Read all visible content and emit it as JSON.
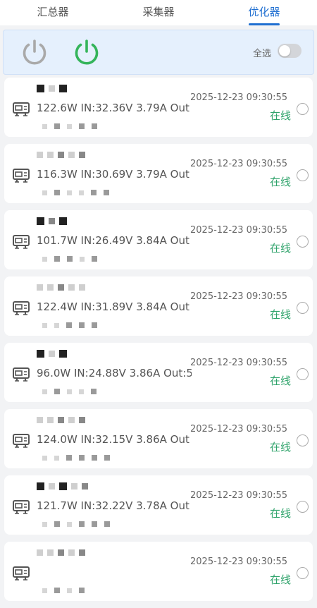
{
  "tabs": [
    {
      "label": "汇总器",
      "active": false
    },
    {
      "label": "采集器",
      "active": false
    },
    {
      "label": "优化器",
      "active": true
    }
  ],
  "control_bar": {
    "power_off_icon": "power-icon-grey",
    "power_on_icon": "power-icon-green",
    "select_all_label": "全选",
    "select_all_on": false,
    "colors": {
      "power_off": "#a9a9a9",
      "power_on": "#34b45a",
      "status_online": "#2fa36b",
      "accent": "#1f6fd1"
    }
  },
  "devices": [
    {
      "readings": "122.6W IN:32.36V 3.79A Out",
      "timestamp": "2025-12-23 09:30:55",
      "status": "在线"
    },
    {
      "readings": "116.3W IN:30.69V 3.79A Out",
      "timestamp": "2025-12-23 09:30:55",
      "status": "在线"
    },
    {
      "readings": "101.7W IN:26.49V 3.84A Out",
      "timestamp": "2025-12-23 09:30:55",
      "status": "在线"
    },
    {
      "readings": "122.4W IN:31.89V 3.84A Out",
      "timestamp": "2025-12-23 09:30:55",
      "status": "在线"
    },
    {
      "readings": "96.0W IN:24.88V 3.86A Out:5",
      "timestamp": "2025-12-23 09:30:55",
      "status": "在线"
    },
    {
      "readings": "124.0W IN:32.15V 3.86A Out",
      "timestamp": "2025-12-23 09:30:55",
      "status": "在线"
    },
    {
      "readings": "121.7W IN:32.22V 3.78A Out",
      "timestamp": "2025-12-23 09:30:55",
      "status": "在线"
    },
    {
      "readings": "",
      "timestamp": "2025-12-23 09:30:55",
      "status": "在线"
    }
  ]
}
